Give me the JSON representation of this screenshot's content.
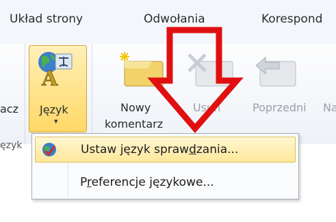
{
  "tabs": [
    "Układ strony",
    "Odwołania",
    "Korespond"
  ],
  "ribbon": {
    "left_partial_label": "acz",
    "language_button": {
      "label": "Język",
      "arrow": "▾"
    },
    "group_label_partial": "ęzyk",
    "new_comment": {
      "line1": "Nowy",
      "line2": "komentarz"
    },
    "delete_label": "Usuń",
    "previous_label": "Poprzedni",
    "next_partial_label": "Na"
  },
  "dropdown": {
    "items": [
      {
        "pre": "Ustaw język spraw",
        "mnemonic": "d",
        "post": "zania...",
        "icon": "spell-check-language-icon"
      },
      {
        "pre": "P",
        "mnemonic": "r",
        "post": "eferencje językowe...",
        "icon": ""
      }
    ]
  },
  "annotation": {
    "color": "#e01010",
    "icon": "down-arrow-annotation"
  }
}
